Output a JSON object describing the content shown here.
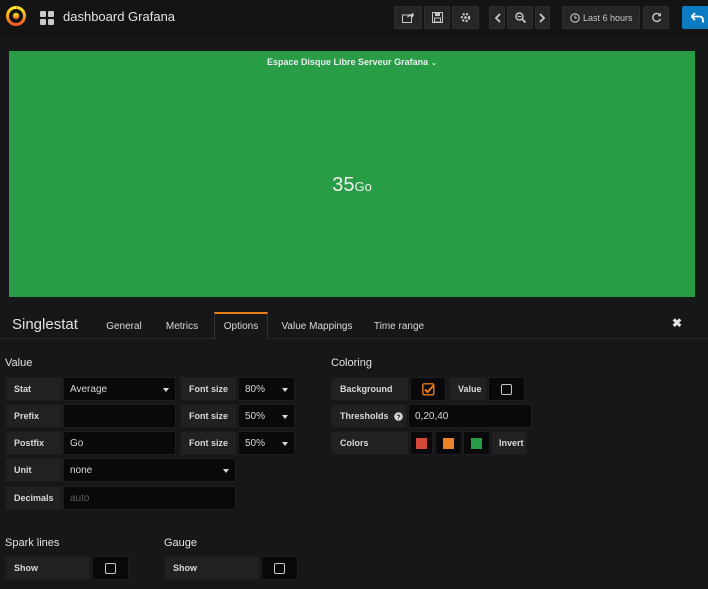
{
  "header": {
    "title": "dashboard Grafana",
    "time_range_label": "Last 6 hours"
  },
  "panel": {
    "title": "Espace Disque Libre Serveur Grafana",
    "value": "35",
    "unit": "Go",
    "background_color": "#299c46"
  },
  "editor": {
    "type": "Singlestat",
    "tabs": [
      "General",
      "Metrics",
      "Options",
      "Value Mappings",
      "Time range"
    ],
    "active_tab": "Options"
  },
  "value_section": {
    "title": "Value",
    "stat_label": "Stat",
    "stat_value": "Average",
    "prefix_label": "Prefix",
    "prefix_value": "",
    "postfix_label": "Postfix",
    "postfix_value": "Go",
    "unit_label": "Unit",
    "unit_value": "none",
    "decimals_label": "Decimals",
    "decimals_placeholder": "auto",
    "font_size_label": "Font size",
    "font_sizes": [
      "80%",
      "50%",
      "50%"
    ]
  },
  "coloring": {
    "title": "Coloring",
    "background_label": "Background",
    "background_checked": true,
    "value_label": "Value",
    "value_checked": false,
    "thresholds_label": "Thresholds",
    "thresholds_value": "0,20,40",
    "colors_label": "Colors",
    "colors": [
      "#d44a3a",
      "#ed8128",
      "#299c46"
    ],
    "invert_label": "Invert"
  },
  "spark_lines": {
    "title": "Spark lines",
    "show_label": "Show",
    "checked": false
  },
  "gauge": {
    "title": "Gauge",
    "show_label": "Show",
    "checked": false
  },
  "accent_color": "#eb7b18"
}
